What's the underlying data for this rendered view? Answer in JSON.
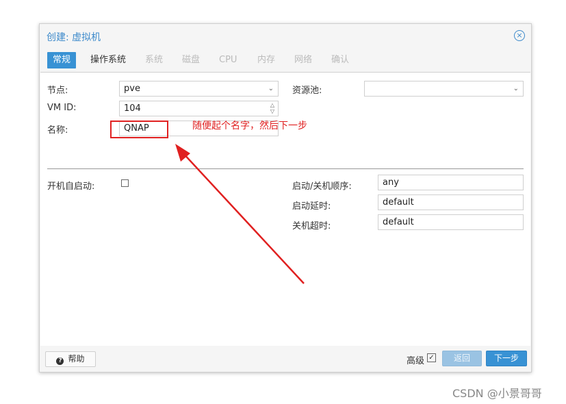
{
  "dialog": {
    "title": "创建: 虚拟机",
    "close_icon": "×"
  },
  "tabs": [
    {
      "label": "常规",
      "state": "active"
    },
    {
      "label": "操作系统",
      "state": "enabled"
    },
    {
      "label": "系统",
      "state": "disabled"
    },
    {
      "label": "磁盘",
      "state": "disabled"
    },
    {
      "label": "CPU",
      "state": "disabled"
    },
    {
      "label": "内存",
      "state": "disabled"
    },
    {
      "label": "网络",
      "state": "disabled"
    },
    {
      "label": "确认",
      "state": "disabled"
    }
  ],
  "form": {
    "node_label": "节点:",
    "node_value": "pve",
    "pool_label": "资源池:",
    "pool_value": "",
    "vmid_label": "VM ID:",
    "vmid_value": "104",
    "name_label": "名称:",
    "name_value": "QNAP",
    "onboot_label": "开机自启动:",
    "order_label": "启动/关机顺序:",
    "order_value": "any",
    "startup_delay_label": "启动延时:",
    "startup_delay_value": "default",
    "shutdown_timeout_label": "关机超时:",
    "shutdown_timeout_value": "default"
  },
  "footer": {
    "help_label": "帮助",
    "advanced_label": "高级",
    "back_label": "返回",
    "next_label": "下一步"
  },
  "annotation": {
    "text": "随便起个名字，然后下一步",
    "color": "#e02020"
  },
  "watermark": "CSDN @小景哥哥",
  "colors": {
    "accent": "#3892d4",
    "title": "#3d8acb"
  }
}
